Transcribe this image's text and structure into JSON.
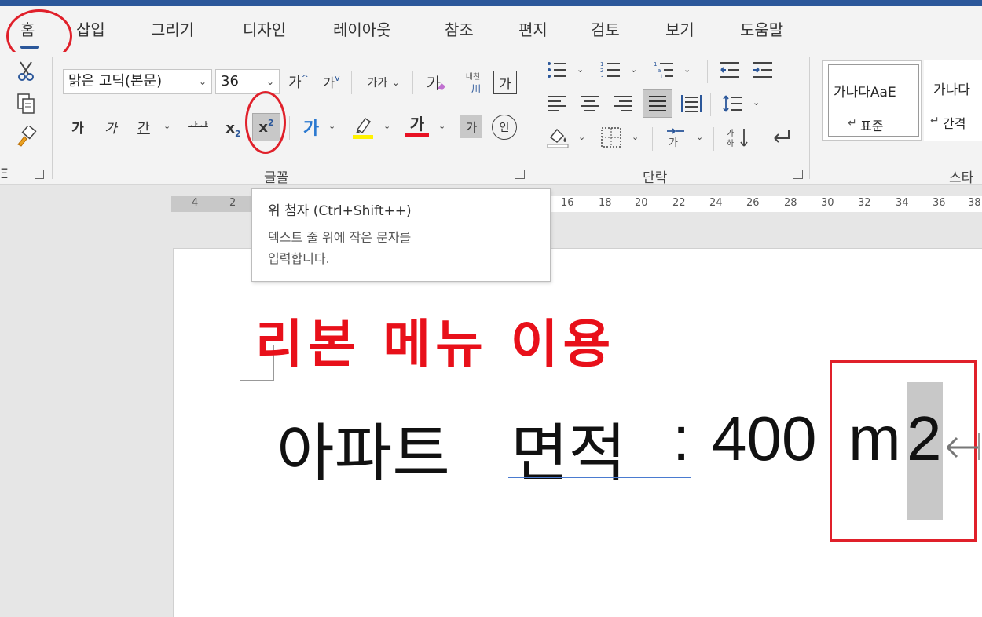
{
  "ribbon_tabs": [
    "홈",
    "삽입",
    "그리기",
    "디자인",
    "레이아웃",
    "참조",
    "편지",
    "검토",
    "보기",
    "도움말"
  ],
  "font": {
    "font_name": "맑은 고딕(본문)",
    "font_size": "36",
    "grow_font": "가",
    "shrink_font": "가",
    "change_case": "가가",
    "clear_format": "가",
    "phonetic_guide": "내천",
    "phonetic_sub": "川",
    "char_border": "가",
    "bold": "가",
    "italic": "가",
    "underline": "간",
    "strikethrough": "ᅪᅪ",
    "subscript_base": "x",
    "subscript_mark": "2",
    "superscript_base": "x",
    "superscript_mark": "2",
    "text_effects": "가",
    "font_color": "가",
    "char_shading": "가",
    "enclose_char": "인",
    "group_label": "글꼴"
  },
  "paragraph": {
    "group_label": "단락"
  },
  "styles": {
    "items": [
      {
        "preview": "가나다AaE",
        "name": "표준"
      },
      {
        "preview": "가나다",
        "name": "간격"
      }
    ],
    "group_label": "스타"
  },
  "clipboard": {
    "group_label": "Ξ"
  },
  "ruler": {
    "numbers": [
      "4",
      "2",
      "16",
      "18",
      "20",
      "22",
      "24",
      "26",
      "28",
      "30",
      "32",
      "34",
      "36",
      "38"
    ]
  },
  "tooltip": {
    "title": "위 첨자 (Ctrl+Shift++)",
    "line1": "텍스트 줄 위에 작은 문자를",
    "line2": "입력합니다."
  },
  "annotation": {
    "text": "리본 메뉴 이용"
  },
  "document": {
    "word1": "아파트",
    "word2": "면적",
    "colon": ":",
    "number": "400",
    "unit_m": "m",
    "unit_2": "2"
  },
  "colors": {
    "accent": "#2b579a",
    "highlight_circle": "#e0202a",
    "annotation": "#e8101a",
    "font_color_bar": "#e81123",
    "highlight_bar": "#fff200"
  }
}
